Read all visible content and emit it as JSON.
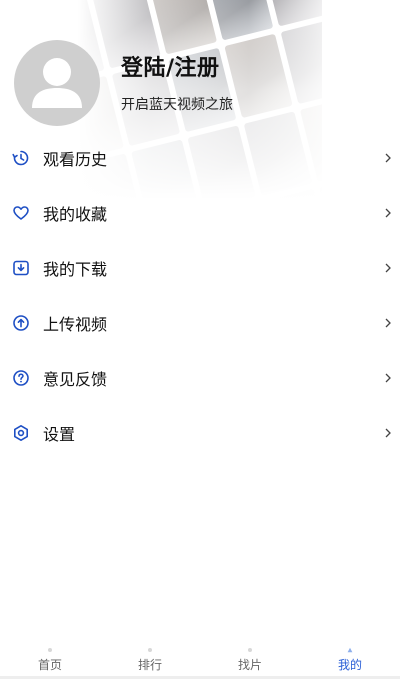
{
  "profile": {
    "title": "登陆/注册",
    "subtitle": "开启蓝天视频之旅"
  },
  "menu": {
    "items": [
      {
        "label": "观看历史",
        "icon": "history-icon"
      },
      {
        "label": "我的收藏",
        "icon": "heart-icon"
      },
      {
        "label": "我的下载",
        "icon": "download-icon"
      },
      {
        "label": "上传视频",
        "icon": "upload-icon"
      },
      {
        "label": "意见反馈",
        "icon": "question-icon"
      },
      {
        "label": "设置",
        "icon": "gear-icon"
      }
    ]
  },
  "tabbar": {
    "tabs": [
      {
        "label": "首页"
      },
      {
        "label": "排行"
      },
      {
        "label": "找片"
      },
      {
        "label": "我的"
      }
    ],
    "active_index": 3
  },
  "colors": {
    "accent": "#2a5fd6",
    "icon_blue": "#1e4fc4",
    "avatar_bg": "#cfcfcf"
  }
}
